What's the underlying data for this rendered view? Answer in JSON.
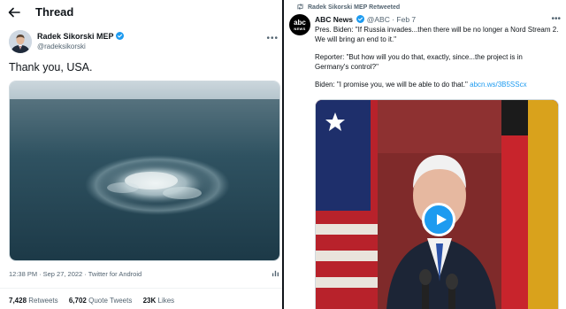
{
  "left_panel": {
    "header_title": "Thread",
    "author": {
      "name": "Radek Sikorski MEP",
      "handle": "@radeksikorski"
    },
    "tweet_text": "Thank you, USA.",
    "meta": {
      "time": "12:38 PM",
      "date": "Sep 27, 2022",
      "source": "Twitter for Android"
    },
    "stats": {
      "retweets_count": "7,428",
      "retweets_label": "Retweets",
      "quotes_count": "6,702",
      "quotes_label": "Quote Tweets",
      "likes_count": "23K",
      "likes_label": "Likes"
    }
  },
  "right_panel": {
    "retweet_context": "Radek Sikorski MEP Retweeted",
    "author": {
      "avatar_text": "abc",
      "avatar_subtext": "NEWS",
      "name": "ABC News",
      "handle": "@ABC",
      "date": "Feb 7"
    },
    "tweet_lines": {
      "line1": "Pres. Biden: \"If Russia invades...then there will be no longer a Nord Stream 2.",
      "line2": "We will bring an end to it.\"",
      "line3": "Reporter: \"But how will you do that, exactly, since...the project is in",
      "line4": "Germany's control?\"",
      "line5": "Biden: \"I promise you, we will be able to do that.\"",
      "link": "abcn.ws/3B5SScx"
    }
  },
  "colors": {
    "accent": "#1d9bf0",
    "text": "#0f1419",
    "muted": "#536471"
  }
}
